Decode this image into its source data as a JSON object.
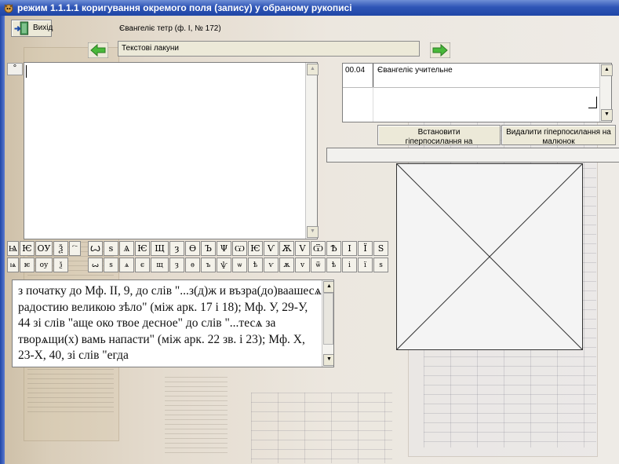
{
  "window": {
    "title": "режим 1.1.1.1 коригування окремого поля (запису) у обраному рукописі"
  },
  "toolbar": {
    "exit_label": "Вихід"
  },
  "manuscript": {
    "title": "Євангеліє тетр (ф. І, № 172)",
    "field": "Текстові лакуни"
  },
  "editor": {
    "marker": "°",
    "content": ""
  },
  "hyperlinks": {
    "rows": [
      {
        "code": "00.04",
        "title": "Євангеліє учительне"
      }
    ],
    "set_button": "Встановити гіперпосилання на",
    "delete_button": "Видалити гіперпосилання на малюнок"
  },
  "keyboard": {
    "upper": [
      "Ѩ",
      "Ѥ",
      "ОУ",
      "Ѯ",
      "҇",
      "Ꙍ",
      "ѕ",
      "Ѧ",
      "Ѥ",
      "Щ",
      "ȝ",
      "Ѳ",
      "Ъ",
      "Ψ",
      "Ѡ",
      "Ѥ",
      "Ѵ",
      "Ѫ",
      "V",
      "Ѿ",
      "Ѣ",
      "І",
      "Ї",
      "Ѕ"
    ],
    "lower": [
      "ѩ",
      "ѥ",
      "оу",
      "ѯ",
      "ꙍ",
      "ѕ",
      "ѧ",
      "є",
      "щ",
      "ȝ",
      "ѳ",
      "ъ",
      "ѱ",
      "ѡ",
      "ѣ",
      "ѵ",
      "ѫ",
      "v",
      "ѿ",
      "ѣ",
      "і",
      "ї",
      "ѕ"
    ]
  },
  "text_panel": {
    "content": "з початку до Мф. II, 9, до слів \"...з(д)ж и възра(до)ваашесѧ радостию великою зѣло\" (між арк. 17 і 18); Мф. У, 29-У, 44 зі слів \"аще око твое десное\" до слів \"...тесѧ за творѧщи(х) вамь напасти\" (між арк. 22 зв. і 23); Мф. Х, 23-Х, 40, зі слів \"егда"
  },
  "colors": {
    "titlebar": "#2f55b6",
    "arrow": "#49b93a"
  }
}
